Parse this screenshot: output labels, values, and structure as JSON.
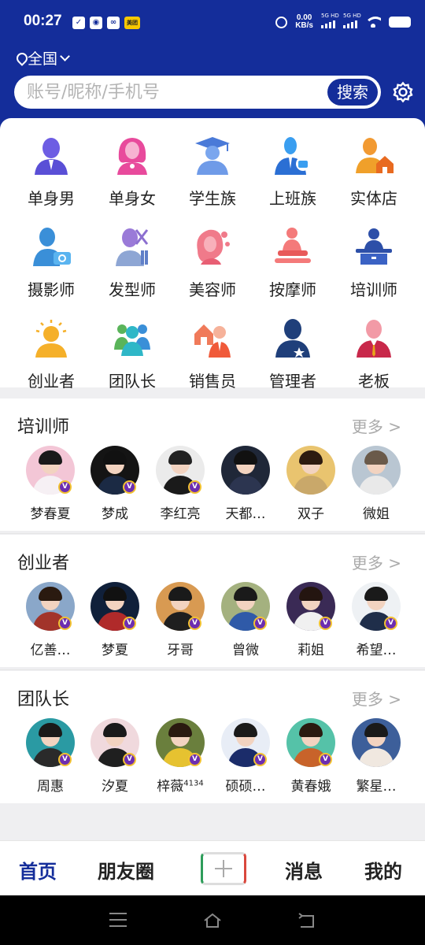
{
  "status_bar": {
    "time": "00:27",
    "net_speed": "0.00",
    "net_unit": "KB/s",
    "sig1": "5G HD",
    "sig2": "5G HD"
  },
  "location": {
    "label": "全国"
  },
  "search": {
    "placeholder": "账号/昵称/手机号",
    "button": "搜索"
  },
  "categories": [
    {
      "label": "单身男",
      "icon": "single-man-icon"
    },
    {
      "label": "单身女",
      "icon": "single-woman-icon"
    },
    {
      "label": "学生族",
      "icon": "student-icon"
    },
    {
      "label": "上班族",
      "icon": "office-worker-icon"
    },
    {
      "label": "实体店",
      "icon": "store-icon"
    },
    {
      "label": "摄影师",
      "icon": "photographer-icon"
    },
    {
      "label": "发型师",
      "icon": "hairstylist-icon"
    },
    {
      "label": "美容师",
      "icon": "beautician-icon"
    },
    {
      "label": "按摩师",
      "icon": "masseur-icon"
    },
    {
      "label": "培训师",
      "icon": "trainer-icon"
    },
    {
      "label": "创业者",
      "icon": "entrepreneur-icon"
    },
    {
      "label": "团队长",
      "icon": "team-leader-icon"
    },
    {
      "label": "销售员",
      "icon": "salesperson-icon"
    },
    {
      "label": "管理者",
      "icon": "manager-icon"
    },
    {
      "label": "老板",
      "icon": "boss-icon"
    }
  ],
  "sections": [
    {
      "title": "培训师",
      "more": "更多 >",
      "people": [
        {
          "name": "梦春夏",
          "verified": true,
          "bg": "#f3c6d6",
          "cloth": "#f6f0f4",
          "hair": "#1a1a1a"
        },
        {
          "name": "梦成",
          "verified": true,
          "bg": "#141414",
          "cloth": "#1b2a44",
          "hair": "#111111"
        },
        {
          "name": "李红亮",
          "verified": true,
          "bg": "#ebebeb",
          "cloth": "#1a1a1a",
          "hair": "#222222"
        },
        {
          "name": "天都…",
          "verified": false,
          "bg": "#1f2738",
          "cloth": "#2c3550",
          "hair": "#111111"
        },
        {
          "name": "双子",
          "verified": false,
          "bg": "#e9c46f",
          "cloth": "#c9a86a",
          "hair": "#2d1b10"
        },
        {
          "name": "微姐",
          "verified": false,
          "bg": "#b9c6d2",
          "cloth": "#e9e9e9",
          "hair": "#6a5a4a"
        }
      ]
    },
    {
      "title": "创业者",
      "more": "更多 >",
      "people": [
        {
          "name": "亿善…",
          "verified": true,
          "bg": "#8aa7c9",
          "cloth": "#a2342a",
          "hair": "#2a1a10"
        },
        {
          "name": "梦夏",
          "verified": true,
          "bg": "#10203a",
          "cloth": "#b02a2a",
          "hair": "#111111"
        },
        {
          "name": "牙哥",
          "verified": true,
          "bg": "#d89a52",
          "cloth": "#1f1f1f",
          "hair": "#1a1a1a"
        },
        {
          "name": "曾微",
          "verified": true,
          "bg": "#a4b17f",
          "cloth": "#2f5aa8",
          "hair": "#1a1a1a"
        },
        {
          "name": "莉姐",
          "verified": true,
          "bg": "#3a2a55",
          "cloth": "#f0f0f0",
          "hair": "#241510"
        },
        {
          "name": "希望…",
          "verified": true,
          "bg": "#eef1f4",
          "cloth": "#1f2e4a",
          "hair": "#1a1a1a"
        }
      ]
    },
    {
      "title": "团队长",
      "more": "更多 >",
      "people": [
        {
          "name": "周惠",
          "verified": true,
          "bg": "#2a9aa3",
          "cloth": "#2a2a2a",
          "hair": "#1a1a1a"
        },
        {
          "name": "汐夏",
          "verified": true,
          "bg": "#f0d9dd",
          "cloth": "#1f1f1f",
          "hair": "#1a1a1a"
        },
        {
          "name": "梓薇",
          "sup": "4134",
          "verified": true,
          "bg": "#6a7f3d",
          "cloth": "#e6c230",
          "hair": "#2a1a10"
        },
        {
          "name": "硕硕…",
          "verified": true,
          "bg": "#e8edf6",
          "cloth": "#1b2c6a",
          "hair": "#1a1a1a"
        },
        {
          "name": "黄春娥",
          "verified": true,
          "bg": "#55c2a8",
          "cloth": "#c8632a",
          "hair": "#2a1a10"
        },
        {
          "name": "繁星…",
          "verified": false,
          "bg": "#3d5f9a",
          "cloth": "#f0e8e0",
          "hair": "#1a1a1a"
        }
      ]
    }
  ],
  "bottom_nav": {
    "home": "首页",
    "moments": "朋友圈",
    "messages": "消息",
    "mine": "我的"
  },
  "colors": {
    "brand": "#142d9a",
    "verified_badge": "#6d2eb0"
  }
}
